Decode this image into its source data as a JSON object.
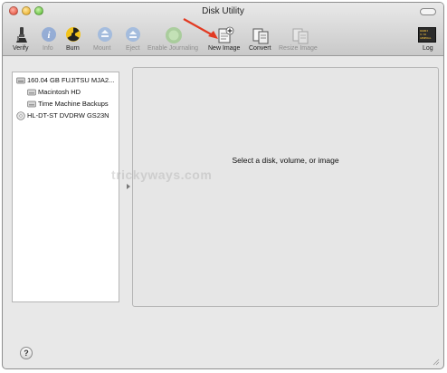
{
  "window": {
    "title": "Disk Utility"
  },
  "toolbar": {
    "verify": "Verify",
    "info": "Info",
    "burn": "Burn",
    "mount": "Mount",
    "eject": "Eject",
    "enable_journaling": "Enable Journaling",
    "new_image": "New Image",
    "convert": "Convert",
    "resize_image": "Resize Image",
    "log": "Log",
    "log_badge": "WARNI\n9:36\nGENERAL"
  },
  "sidebar": {
    "items": [
      {
        "label": "160.04 GB FUJITSU MJA2...",
        "icon": "hard-disk-icon"
      },
      {
        "label": "Macintosh HD",
        "icon": "volume-icon"
      },
      {
        "label": "Time Machine Backups",
        "icon": "volume-icon"
      },
      {
        "label": "HL-DT-ST DVDRW GS23N",
        "icon": "optical-drive-icon"
      }
    ]
  },
  "main": {
    "prompt": "Select a disk, volume, or image"
  },
  "watermark": "trickyways.com",
  "help": "?",
  "colors": {
    "annotation_arrow": "#e23a22",
    "window_bg": "#e8e8e8"
  }
}
